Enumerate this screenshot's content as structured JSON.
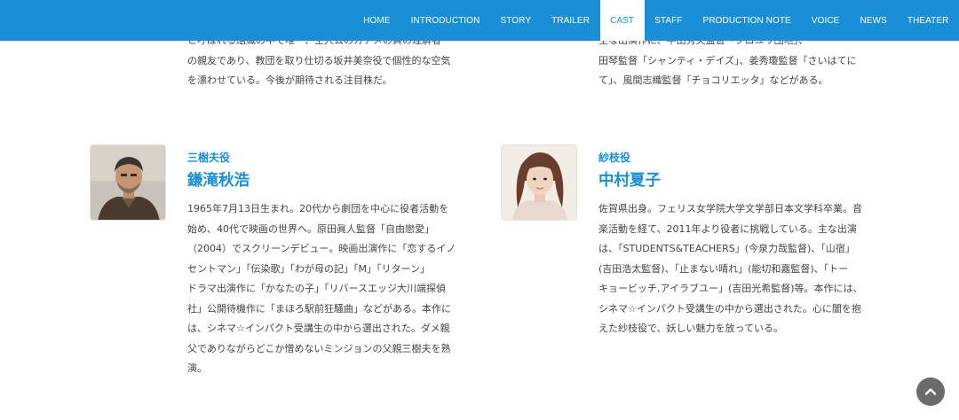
{
  "nav": {
    "items": [
      "HOME",
      "INTRODUCTION",
      "STORY",
      "TRAILER",
      "CAST",
      "STAFF",
      "PRODUCTION NOTE",
      "VOICE",
      "NEWS",
      "THEATER"
    ],
    "active": "CAST"
  },
  "top_left": {
    "cut_line": "と呼ばれる組織の中で唯一、主人公のカナメの真の理解者",
    "lines": [
      "の親友であり、教団を取り仕切る坂井美奈役で個性的な空気",
      "を漂わせている。今後が期待される注目株だ。"
    ]
  },
  "top_right": {
    "cut_line": "主な出演作に、中田秀夫監督「クロユリ団地」、",
    "lines": [
      "田琴監督「シャンティ・デイズ」、姜秀瓊監督「さいはてに",
      "て」、風間志織監督「チョコリエッタ」などがある。"
    ]
  },
  "cast": [
    {
      "role": "三樹夫役",
      "name": "鎌滝秋浩",
      "bio": [
        "1965年7月13日生まれ。20代から劇団を中心に役者活動を",
        "始め、40代で映画の世界へ。原田眞人監督「自由戀愛」",
        "（2004）でスクリーンデビュー。映画出演作に「恋するイノ",
        "セントマン」「伝染歌」「わが母の記」「M」「リターン」",
        "ドラマ出演作に「かなたの子」「リバースエッジ大川端探偵",
        "社」公開待機作に「まほろ駅前狂騒曲」などがある。本作に",
        "は、シネマ☆インパクト受講生の中から選出された。ダメ親",
        "父でありながらどこか憎めないミンジョンの父親三樹夫を熟",
        "演。"
      ]
    },
    {
      "role": "紗枝役",
      "name": "中村夏子",
      "bio": [
        "佐賀県出身。フェリス女学院大学文学部日本文学科卒業。音",
        "楽活動を経て、2011年より役者に挑戦している。主な出演",
        "は、「STUDENTS&TEACHERS」(今泉力哉監督)、「山宿」",
        "(吉田浩太監督)、「止まない晴れ」(能切和嘉監督)、「トー",
        "キョービッチ,アイラブユー」(吉田光希監督)等。本作には、",
        "シネマ☆インパクト受講生の中から選出された。心に闇を抱",
        "えた紗枝役で、妖しい魅力を放っている。"
      ]
    }
  ],
  "colors": {
    "accent": "#1a8fd8",
    "text": "#444444",
    "scroll_button": "#6b6b6b"
  },
  "icons": {
    "scroll_top": "chevron-up-icon"
  }
}
